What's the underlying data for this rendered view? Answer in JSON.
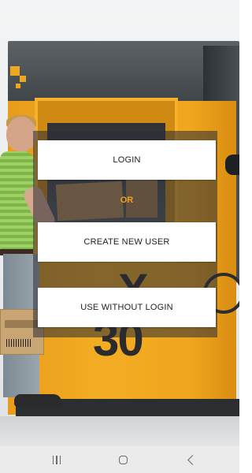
{
  "app": {
    "background_image": "yellow-baler-machine-with-worker",
    "accent_color": "#f2a20f"
  },
  "menu": {
    "login_label": "LOGIN",
    "or_label": "OR",
    "create_user_label": "CREATE NEW USER",
    "use_without_login_label": "USE WITHOUT LOGIN"
  },
  "machine": {
    "model_number": "30",
    "brand_mark": "X"
  },
  "nav_bar": {
    "recents_icon": "recents-icon",
    "home_icon": "home-icon",
    "back_icon": "back-icon"
  }
}
